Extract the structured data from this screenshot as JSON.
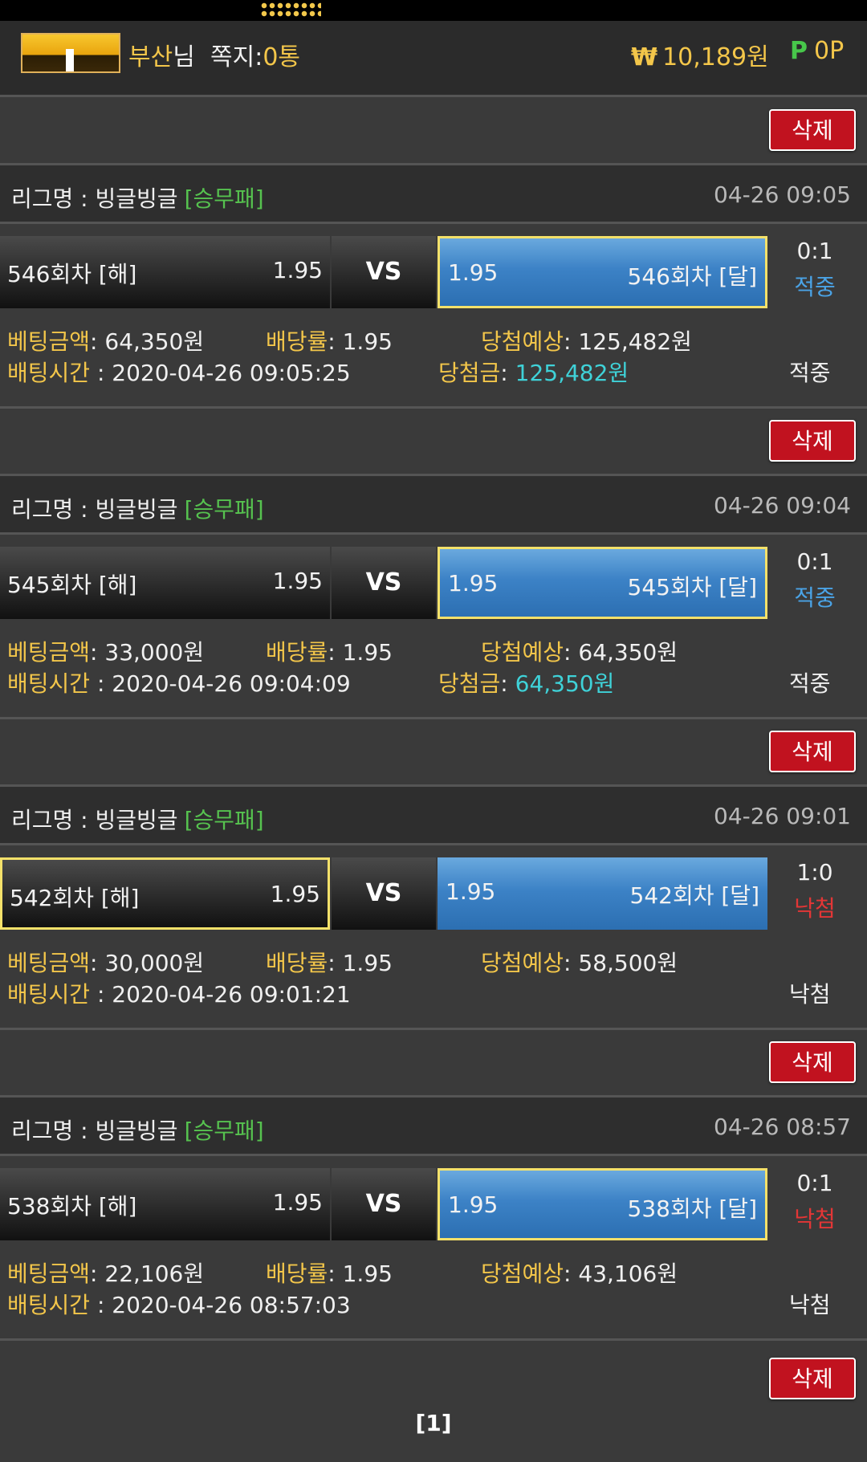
{
  "header": {
    "nickname": "부산",
    "nickname_suffix": "님",
    "message_label": "쪽지:",
    "message_count": "0통",
    "money_symbol": "₩",
    "money": "10,189원",
    "points_symbol": "P",
    "points": "0P"
  },
  "delete_label": "삭제",
  "league_label": "리그명 : 빙글빙글",
  "league_type": "[승무패]",
  "vs_label": "VS",
  "labels": {
    "bet_amount": "베팅금액",
    "odds": "배당률",
    "expected": "당첨예상",
    "bet_time": "배팅시간",
    "win_amount": "당첨금"
  },
  "bets": [
    {
      "league_time": "04-26 09:05",
      "home_name": "546회차 [해]",
      "home_odds": "1.95",
      "away_odds": "1.95",
      "away_name": "546회차 [달]",
      "selected": "away",
      "score": "0:1",
      "result": "적중",
      "bet_amount": ": 64,350원",
      "odds": ": 1.95",
      "expected": ": 125,482원",
      "bet_time": " : 2020-04-26 09:05:25",
      "win_amount": ": ",
      "win_value": "125,482원",
      "final_result": "적중"
    },
    {
      "league_time": "04-26 09:04",
      "home_name": "545회차 [해]",
      "home_odds": "1.95",
      "away_odds": "1.95",
      "away_name": "545회차 [달]",
      "selected": "away",
      "score": "0:1",
      "result": "적중",
      "bet_amount": ": 33,000원",
      "odds": ": 1.95",
      "expected": ": 64,350원",
      "bet_time": " : 2020-04-26 09:04:09",
      "win_amount": ": ",
      "win_value": "64,350원",
      "final_result": "적중"
    },
    {
      "league_time": "04-26 09:01",
      "home_name": "542회차 [해]",
      "home_odds": "1.95",
      "away_odds": "1.95",
      "away_name": "542회차 [달]",
      "selected": "home",
      "score": "1:0",
      "result": "낙첨",
      "bet_amount": ": 30,000원",
      "odds": ": 1.95",
      "expected": ": 58,500원",
      "bet_time": " : 2020-04-26 09:01:21",
      "final_result": "낙첨"
    },
    {
      "league_time": "04-26 08:57",
      "home_name": "538회차 [해]",
      "home_odds": "1.95",
      "away_odds": "1.95",
      "away_name": "538회차 [달]",
      "selected": "away",
      "score": "0:1",
      "result": "낙첨",
      "bet_amount": ": 22,106원",
      "odds": ": 1.95",
      "expected": ": 43,106원",
      "bet_time": " : 2020-04-26 08:57:03",
      "final_result": "낙첨"
    }
  ],
  "pager": "[1]",
  "colors": {
    "hit": "#4aa3e6",
    "miss": "#e33636",
    "win_result": "#f3c64a"
  }
}
